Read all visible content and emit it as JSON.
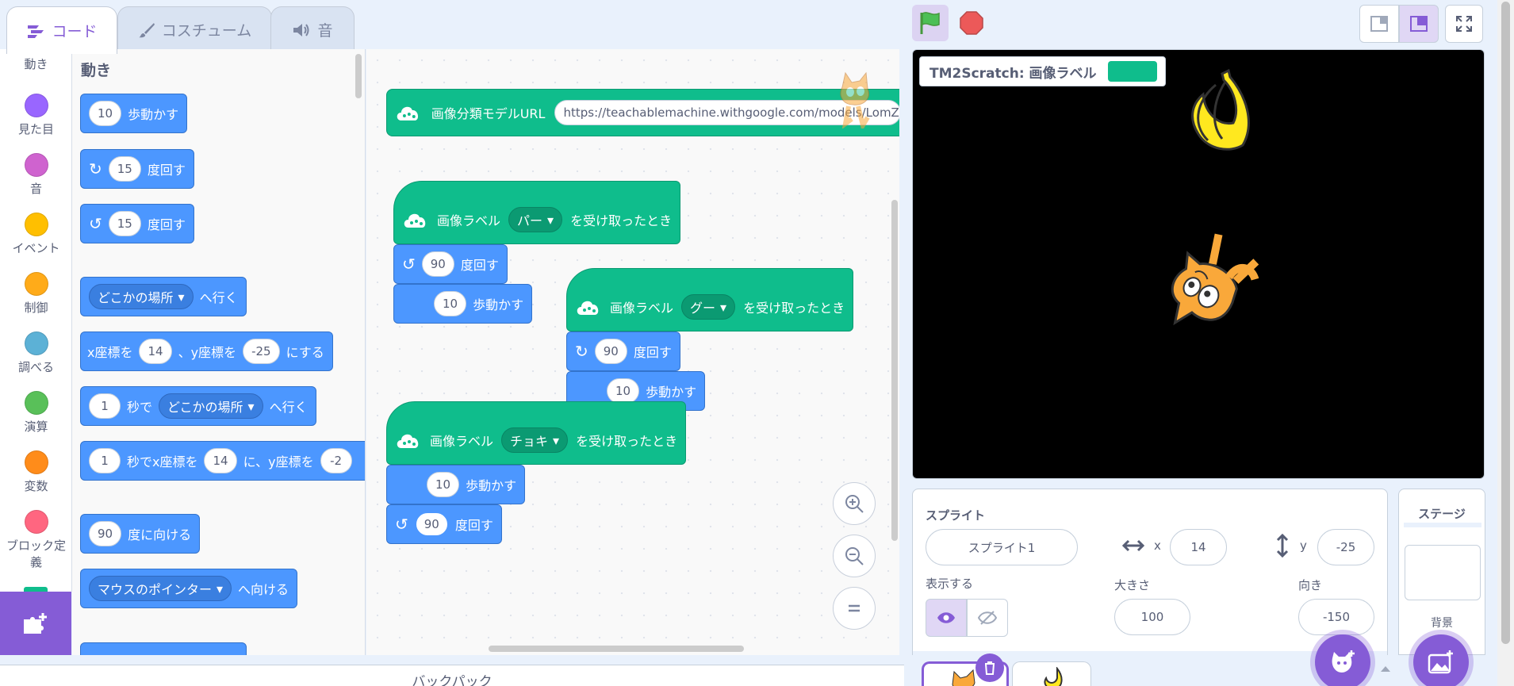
{
  "tabs": [
    {
      "label": "コード"
    },
    {
      "label": "コスチューム"
    },
    {
      "label": "音"
    }
  ],
  "categories": [
    {
      "label": "動き",
      "color": "#4c97ff"
    },
    {
      "label": "見た目",
      "color": "#9966ff"
    },
    {
      "label": "音",
      "color": "#cf63cf"
    },
    {
      "label": "イベント",
      "color": "#ffbf00"
    },
    {
      "label": "制御",
      "color": "#ffab19"
    },
    {
      "label": "調べる",
      "color": "#5cb1d6"
    },
    {
      "label": "演算",
      "color": "#59c059"
    },
    {
      "label": "変数",
      "color": "#ff8c1a"
    },
    {
      "label": "ブロック定義",
      "color": "#ff6680"
    }
  ],
  "palette": {
    "heading": "動き",
    "move": {
      "value": "10",
      "label": "歩動かす"
    },
    "turn_right": {
      "value": "15",
      "label": "度回す"
    },
    "turn_left": {
      "value": "15",
      "label": "度回す"
    },
    "goto": {
      "option": "どこかの場所",
      "label": "へ行く"
    },
    "set_xy": {
      "prefix": "x座標を",
      "x": "14",
      "mid": "、y座標を",
      "y": "-25",
      "suffix": "にする"
    },
    "glide_to": {
      "secs": "1",
      "mid": "秒で",
      "option": "どこかの場所",
      "suffix": "へ行く"
    },
    "glide_xy": {
      "secs": "1",
      "mid": "秒でx座標を",
      "x": "14",
      "mid2": "に、y座標を",
      "y": "-2"
    },
    "point_dir": {
      "value": "90",
      "label": "度に向ける"
    },
    "point_towards": {
      "option": "マウスのポインター",
      "label": "へ向ける"
    }
  },
  "workspace": {
    "url_block": {
      "label": "画像分類モデルURL",
      "url": "https://teachablemachine.withgoogle.com/models/LomZxE"
    },
    "script1": {
      "prefix": "画像ラベル",
      "option": "パー",
      "suffix": "を受け取ったとき",
      "turn": {
        "value": "90",
        "label": "度回す"
      },
      "move": {
        "value": "10",
        "label": "歩動かす"
      }
    },
    "script2": {
      "prefix": "画像ラベル",
      "option": "グー",
      "suffix": "を受け取ったとき",
      "turn": {
        "value": "90",
        "label": "度回す"
      },
      "move": {
        "value": "10",
        "label": "歩動かす"
      }
    },
    "script3": {
      "prefix": "画像ラベル",
      "option": "チョキ",
      "suffix": "を受け取ったとき",
      "move": {
        "value": "10",
        "label": "歩動かす"
      },
      "turn": {
        "value": "90",
        "label": "度回す"
      }
    }
  },
  "stage": {
    "monitor_label": "TM2Scratch: 画像ラベル",
    "monitor_color": "#0fbd8c"
  },
  "sprite_info": {
    "title": "スプライト",
    "name": "スプライト1",
    "x_label": "x",
    "x": "14",
    "y_label": "y",
    "y": "-25",
    "show_label": "表示する",
    "size_label": "大きさ",
    "size": "100",
    "direction_label": "向き",
    "direction": "-150"
  },
  "stage_pane": {
    "title": "ステージ",
    "backdrop_label": "背景"
  },
  "backpack": {
    "label": "バックパック"
  }
}
